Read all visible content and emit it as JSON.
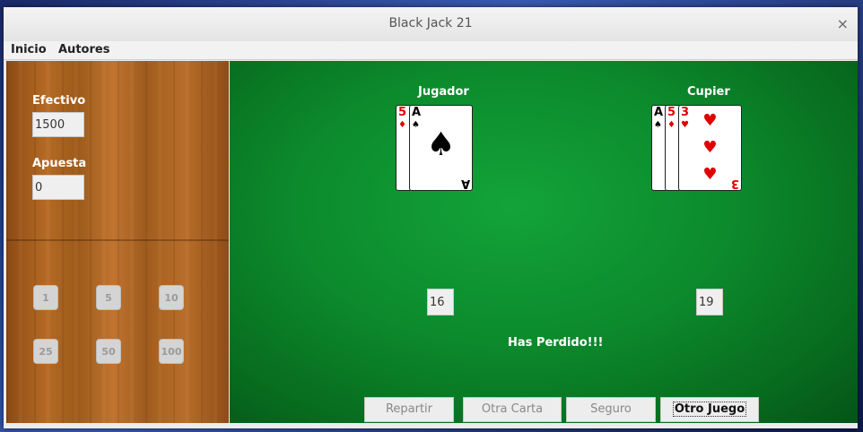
{
  "window": {
    "title": "Black Jack 21",
    "close_icon": "×"
  },
  "menu": {
    "items": [
      "Inicio",
      "Autores"
    ]
  },
  "sidebar": {
    "cash_label": "Efectivo",
    "cash_value": "1500",
    "bet_label": "Apuesta",
    "bet_value": "0",
    "chips": [
      "1",
      "5",
      "10",
      "25",
      "50",
      "100"
    ]
  },
  "table": {
    "player_label": "Jugador",
    "dealer_label": "Cupier",
    "player_cards": [
      {
        "rank": "5",
        "suit": "♦",
        "color": "#e00000"
      },
      {
        "rank": "A",
        "suit": "♠",
        "color": "#000000"
      }
    ],
    "dealer_cards": [
      {
        "rank": "A",
        "suit": "♠",
        "color": "#000000"
      },
      {
        "rank": "5",
        "suit": "♦",
        "color": "#e00000"
      },
      {
        "rank": "3",
        "suit": "♥",
        "color": "#e00000"
      }
    ],
    "player_score": "16",
    "dealer_score": "19",
    "message": "Has Perdido!!!"
  },
  "buttons": {
    "deal": "Repartir",
    "hit": "Otra Carta",
    "insurance": "Seguro",
    "new_game": "Otro Juego"
  },
  "colors": {
    "felt": "#0c8a2c",
    "wood": "#a86222",
    "red_suit": "#e00000"
  }
}
